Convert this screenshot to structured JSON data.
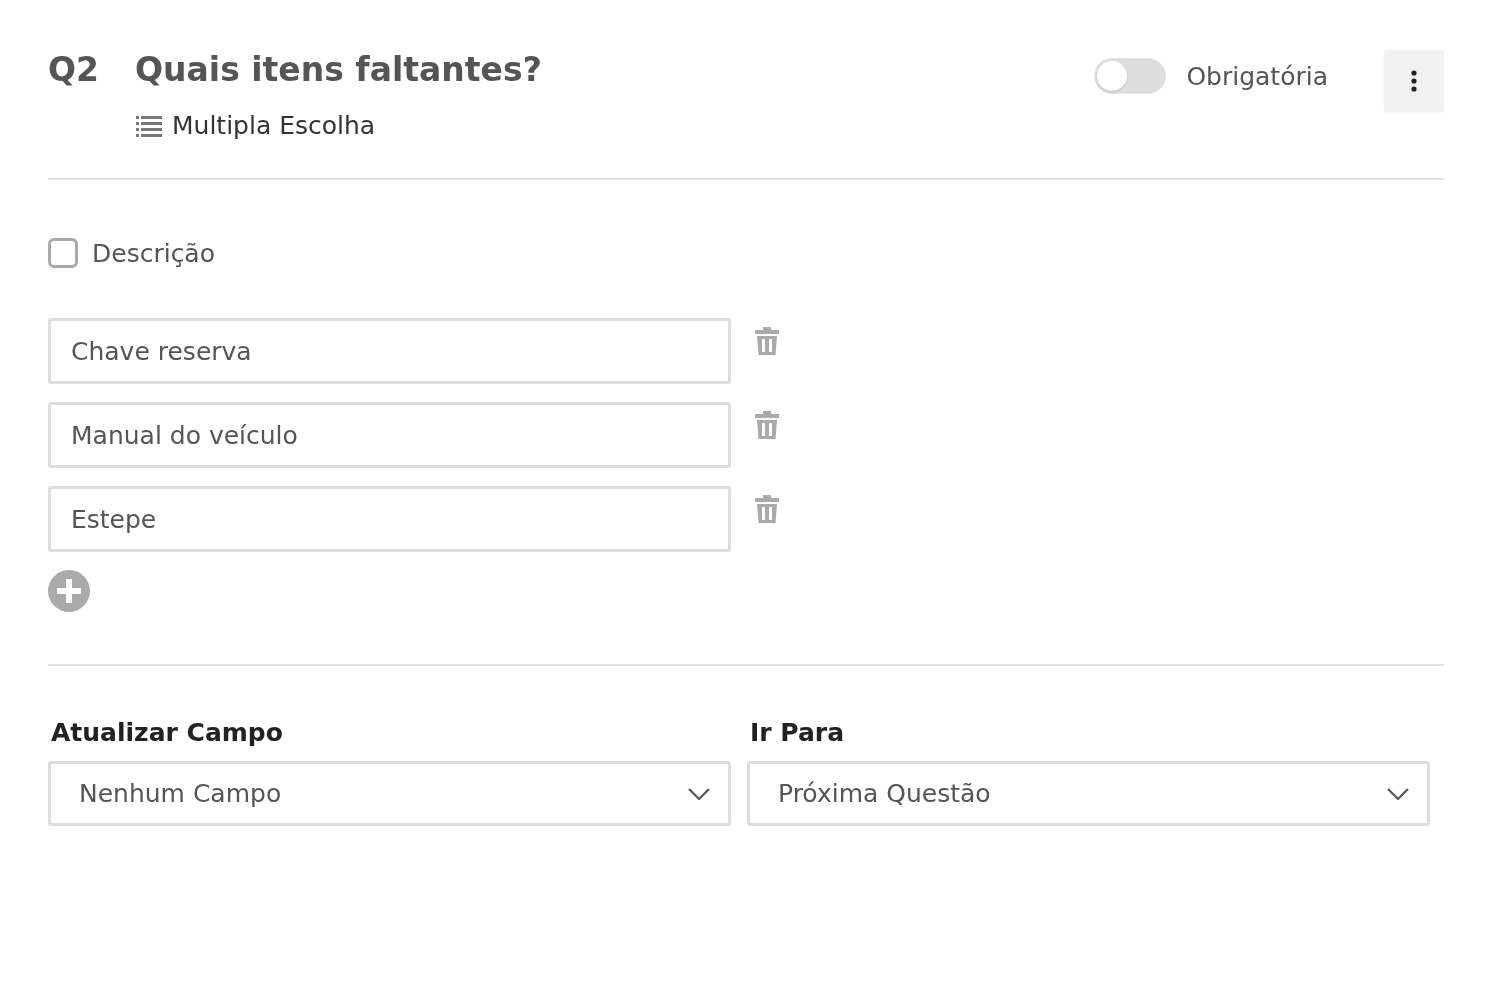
{
  "question": {
    "number": "Q2",
    "title": "Quais itens faltantes?",
    "type": "Multipla Escolha"
  },
  "required_toggle": {
    "label": "Obrigatória",
    "on": false
  },
  "description_checkbox": {
    "label": "Descrição",
    "checked": false
  },
  "options": [
    {
      "value": "Chave reserva"
    },
    {
      "value": "Manual do veículo"
    },
    {
      "value": "Estepe"
    }
  ],
  "selects": [
    {
      "label": "Atualizar Campo",
      "value": "Nenhum Campo"
    },
    {
      "label": "Ir Para",
      "value": "Próxima Questão"
    }
  ]
}
